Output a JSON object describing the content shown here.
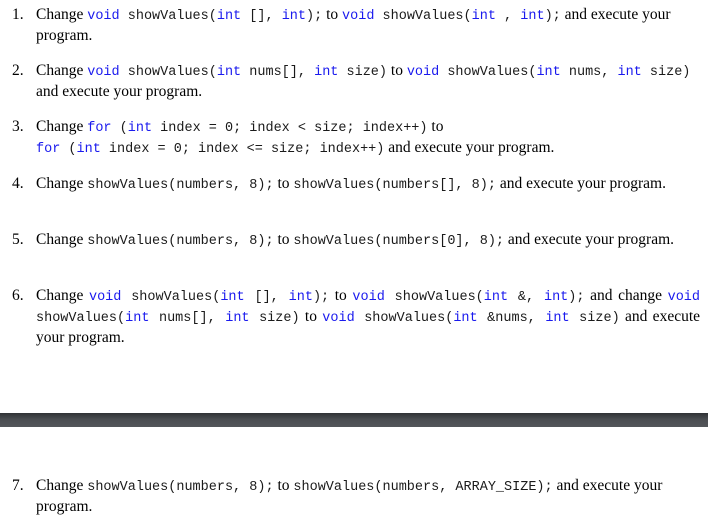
{
  "items": [
    {
      "number": "1.",
      "segments": [
        {
          "t": "text",
          "v": "Change "
        },
        {
          "t": "kw",
          "v": "void"
        },
        {
          "t": "code",
          "v": " showValues("
        },
        {
          "t": "kw",
          "v": "int"
        },
        {
          "t": "code",
          "v": " [], "
        },
        {
          "t": "kw",
          "v": "int"
        },
        {
          "t": "code",
          "v": ");"
        },
        {
          "t": "text",
          "v": " to "
        },
        {
          "t": "kw",
          "v": "void"
        },
        {
          "t": "code",
          "v": " showValues("
        },
        {
          "t": "kw",
          "v": "int"
        },
        {
          "t": "code",
          "v": " , "
        },
        {
          "t": "kw",
          "v": "int"
        },
        {
          "t": "code",
          "v": ");"
        },
        {
          "t": "text",
          "v": " and execute your program."
        }
      ]
    },
    {
      "number": "2.",
      "segments": [
        {
          "t": "text",
          "v": "Change "
        },
        {
          "t": "kw",
          "v": "void"
        },
        {
          "t": "code",
          "v": " showValues("
        },
        {
          "t": "kw",
          "v": "int"
        },
        {
          "t": "code",
          "v": " nums[], "
        },
        {
          "t": "kw",
          "v": "int"
        },
        {
          "t": "code",
          "v": " size)"
        },
        {
          "t": "text",
          "v": " to "
        },
        {
          "t": "kw",
          "v": "void"
        },
        {
          "t": "code",
          "v": " showValues("
        },
        {
          "t": "kw",
          "v": "int"
        },
        {
          "t": "code",
          "v": " nums, "
        },
        {
          "t": "kw",
          "v": "int"
        },
        {
          "t": "code",
          "v": " size)"
        },
        {
          "t": "text",
          "v": " and execute your program."
        }
      ]
    },
    {
      "number": "3.",
      "segments": [
        {
          "t": "text",
          "v": "Change "
        },
        {
          "t": "kw",
          "v": "for"
        },
        {
          "t": "code",
          "v": " ("
        },
        {
          "t": "kw",
          "v": "int"
        },
        {
          "t": "code",
          "v": " index = 0; index < size; index++)"
        },
        {
          "t": "text",
          "v": " to"
        },
        {
          "t": "br",
          "v": ""
        },
        {
          "t": "kw",
          "v": "for"
        },
        {
          "t": "code",
          "v": " ("
        },
        {
          "t": "kw",
          "v": "int"
        },
        {
          "t": "code",
          "v": " index = 0; index <= size; index++)"
        },
        {
          "t": "text",
          "v": " and execute your program."
        }
      ]
    },
    {
      "number": "4.",
      "segments": [
        {
          "t": "text",
          "v": "Change "
        },
        {
          "t": "code",
          "v": "showValues(numbers, 8);"
        },
        {
          "t": "text",
          "v": " to "
        },
        {
          "t": "code",
          "v": "showValues(numbers[], 8);"
        },
        {
          "t": "text",
          "v": " and execute your program."
        }
      ]
    },
    {
      "number": "5.",
      "segments": [
        {
          "t": "text",
          "v": "Change "
        },
        {
          "t": "code",
          "v": "showValues(numbers, 8);"
        },
        {
          "t": "text",
          "v": " to "
        },
        {
          "t": "code",
          "v": "showValues(numbers[0], 8);"
        },
        {
          "t": "text",
          "v": " and execute your program."
        }
      ]
    },
    {
      "number": "6.",
      "segments": [
        {
          "t": "text",
          "v": "Change "
        },
        {
          "t": "kw",
          "v": "void"
        },
        {
          "t": "code",
          "v": " showValues("
        },
        {
          "t": "kw",
          "v": "int"
        },
        {
          "t": "code",
          "v": " [], "
        },
        {
          "t": "kw",
          "v": "int"
        },
        {
          "t": "code",
          "v": ");"
        },
        {
          "t": "text",
          "v": " to "
        },
        {
          "t": "kw",
          "v": "void"
        },
        {
          "t": "code",
          "v": " showValues("
        },
        {
          "t": "kw",
          "v": "int"
        },
        {
          "t": "code",
          "v": " &, "
        },
        {
          "t": "kw",
          "v": "int"
        },
        {
          "t": "code",
          "v": ");"
        },
        {
          "t": "text",
          "v": " and change "
        },
        {
          "t": "kw",
          "v": "void"
        },
        {
          "t": "code",
          "v": " showValues("
        },
        {
          "t": "kw",
          "v": "int"
        },
        {
          "t": "code",
          "v": " nums[], "
        },
        {
          "t": "kw",
          "v": "int"
        },
        {
          "t": "code",
          "v": " size)"
        },
        {
          "t": "text",
          "v": " to "
        },
        {
          "t": "kw",
          "v": "void"
        },
        {
          "t": "code",
          "v": " showValues("
        },
        {
          "t": "kw",
          "v": "int"
        },
        {
          "t": "code",
          "v": " &nums, "
        },
        {
          "t": "kw",
          "v": "int"
        },
        {
          "t": "code",
          "v": " size)"
        },
        {
          "t": "text",
          "v": " and execute your program."
        }
      ]
    },
    {
      "number": "7.",
      "segments": [
        {
          "t": "text",
          "v": "Change "
        },
        {
          "t": "code",
          "v": "showValues(numbers, 8);"
        },
        {
          "t": "text",
          "v": " to "
        },
        {
          "t": "code",
          "v": "showValues(numbers, ARRAY_SIZE);"
        },
        {
          "t": "text",
          "v": " and execute your program."
        }
      ]
    }
  ],
  "colors": {
    "keyword": "#1a1aee",
    "text": "#000000",
    "divider": "#45484c"
  }
}
